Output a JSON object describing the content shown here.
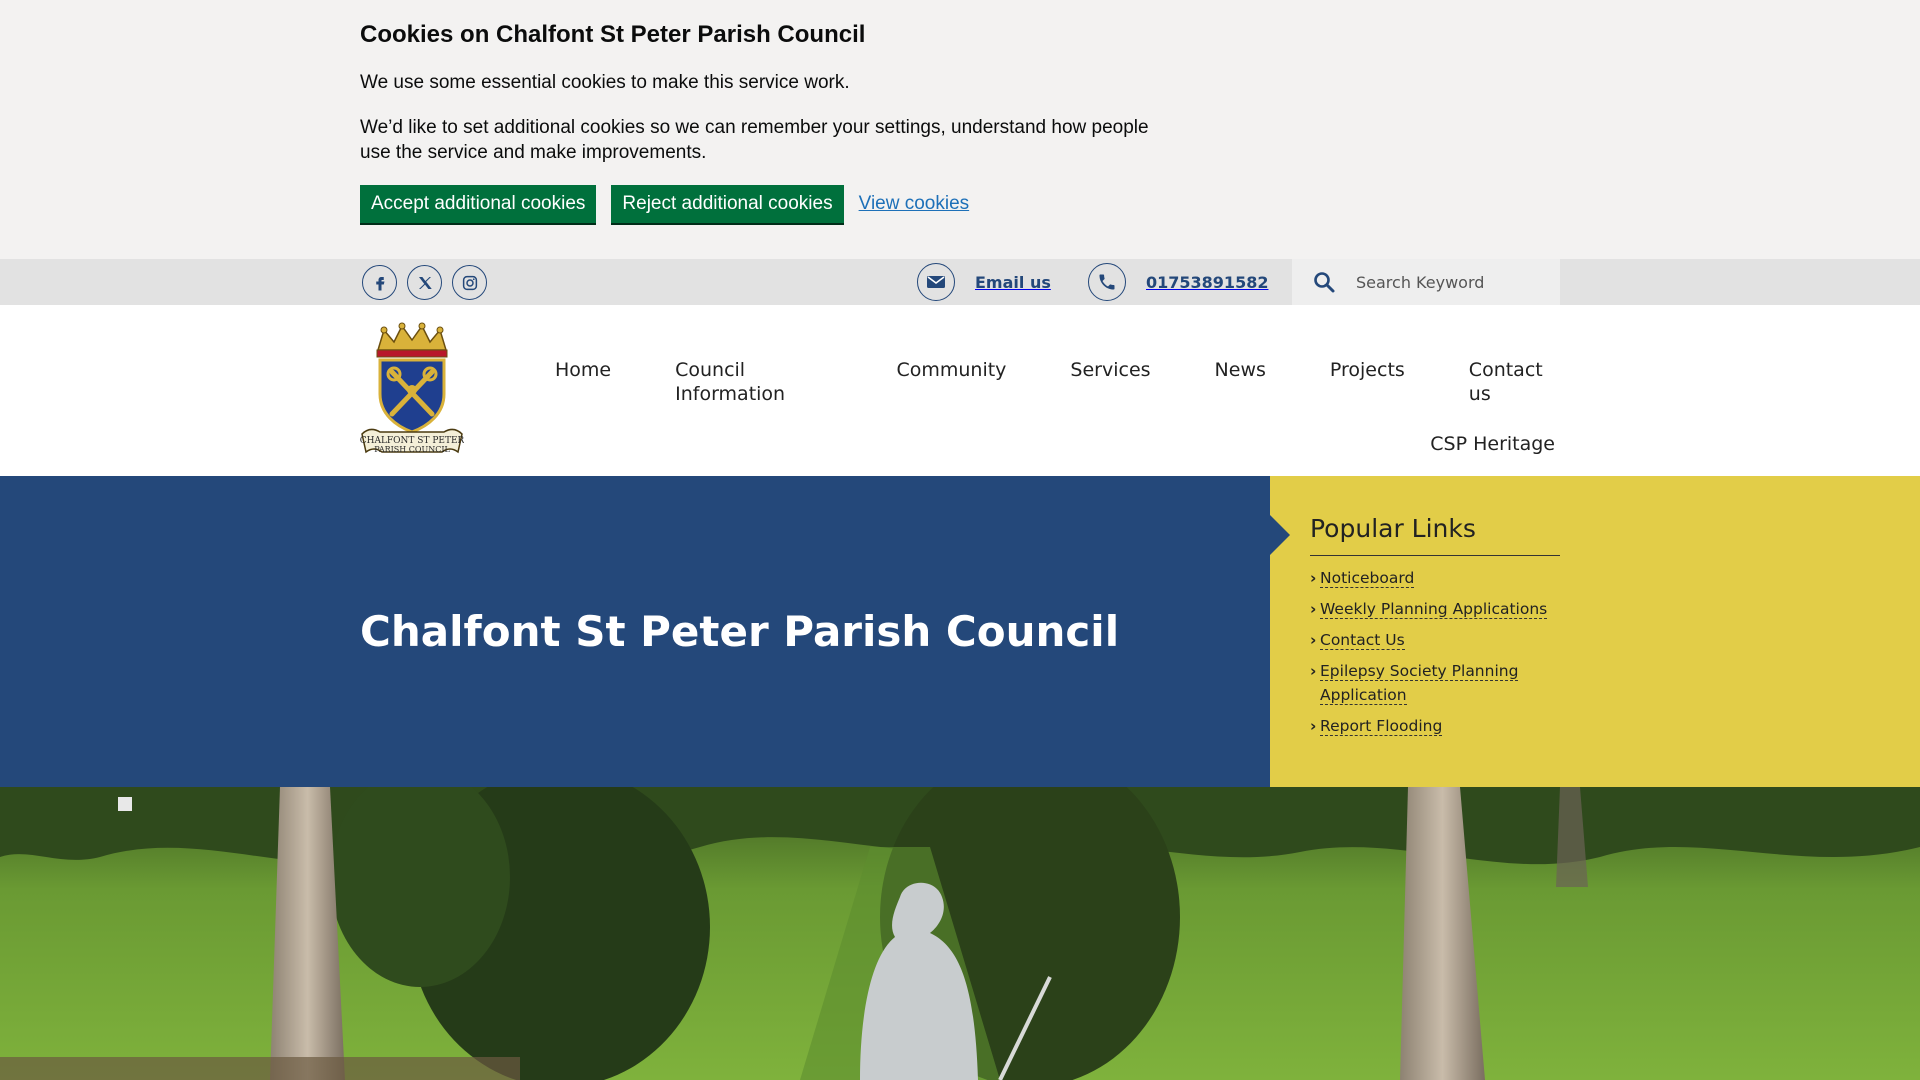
{
  "cookie_banner": {
    "title": "Cookies on Chalfont St Peter Parish Council",
    "text1": "We use some essential cookies to make this service work.",
    "text2": "We’d like to set additional cookies so we can remember your settings, understand how people use the service and make improvements.",
    "accept_label": "Accept additional cookies",
    "reject_label": "Reject additional cookies",
    "view_label": "View cookies"
  },
  "utility": {
    "social": [
      "facebook-icon",
      "x-icon",
      "instagram-icon"
    ],
    "email_label": "Email us",
    "phone_label": "01753891582",
    "search_placeholder": "Search Keyword"
  },
  "nav": {
    "items": [
      "Home",
      "Council Information",
      "Community",
      "Services",
      "News",
      "Projects",
      "Contact us",
      "CSP Heritage"
    ]
  },
  "hero": {
    "title": "Chalfont St Peter Parish Council"
  },
  "popular_links": {
    "title": "Popular Links",
    "items": [
      "Noticeboard",
      "Weekly Planning Applications",
      "Contact Us",
      "Epilepsy Society Planning Application",
      "Report Flooding"
    ]
  },
  "colors": {
    "brand_blue": "#24487a",
    "accent_yellow": "#e2cd48",
    "button_green": "#00703c",
    "banner_bg": "#f3f2f1",
    "link_blue": "#1d70b8"
  }
}
